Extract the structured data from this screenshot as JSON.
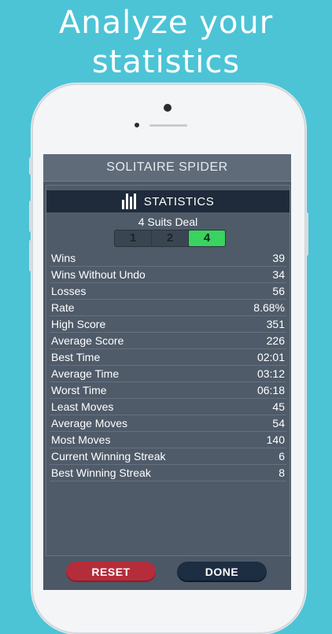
{
  "headline": {
    "line1": "Analyze your",
    "line2": "statistics"
  },
  "app": {
    "title": "SOLITAIRE SPIDER"
  },
  "statistics": {
    "header": "STATISTICS",
    "deal_label": "4 Suits Deal",
    "suit_options": [
      "1",
      "2",
      "4"
    ],
    "selected_suits": "4",
    "rows": [
      {
        "label": "Wins",
        "value": "39"
      },
      {
        "label": "Wins Without Undo",
        "value": "34"
      },
      {
        "label": "Losses",
        "value": "56"
      },
      {
        "label": "Rate",
        "value": "8.68%"
      },
      {
        "label": "High Score",
        "value": "351"
      },
      {
        "label": "Average Score",
        "value": "226"
      },
      {
        "label": "Best Time",
        "value": "02:01"
      },
      {
        "label": "Average Time",
        "value": "03:12"
      },
      {
        "label": "Worst Time",
        "value": "06:18"
      },
      {
        "label": "Least Moves",
        "value": "45"
      },
      {
        "label": "Average Moves",
        "value": "54"
      },
      {
        "label": "Most Moves",
        "value": "140"
      },
      {
        "label": "Current Winning Streak",
        "value": "6"
      },
      {
        "label": "Best Winning Streak",
        "value": "8"
      }
    ]
  },
  "buttons": {
    "reset": "RESET",
    "done": "DONE"
  },
  "colors": {
    "background": "#4cc4d6",
    "panel": "#4c5866",
    "header_bar": "#1f2b3a",
    "active_segment": "#39d35f",
    "reset": "#b52d3a",
    "done": "#1d2d42"
  },
  "icons": {
    "statistics": "bar-chart-icon"
  }
}
